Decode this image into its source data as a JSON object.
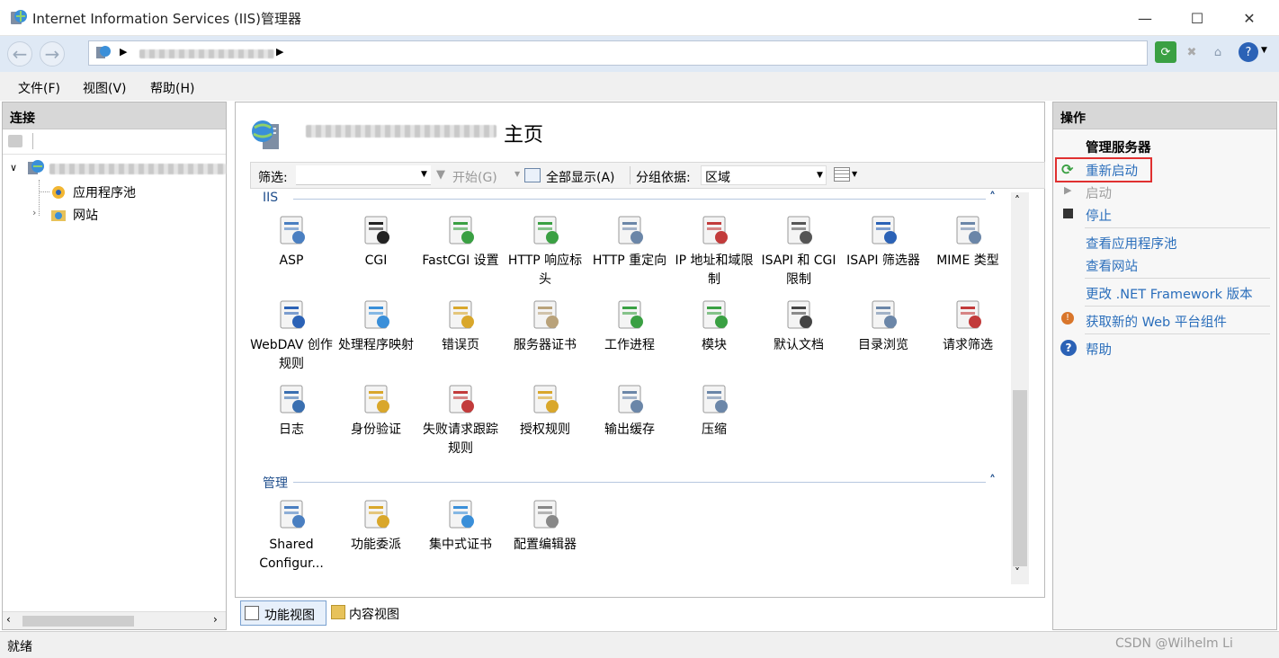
{
  "window": {
    "title": "Internet Information Services (IIS)管理器",
    "minimize": "—",
    "maximize": "☐",
    "close": "✕"
  },
  "menu": [
    "文件(F)",
    "视图(V)",
    "帮助(H)"
  ],
  "connections": {
    "header": "连接",
    "tree": [
      {
        "label": "应用程序池",
        "icon": "app-pool-icon"
      },
      {
        "label": "网站",
        "icon": "sites-folder-icon"
      }
    ]
  },
  "center": {
    "title_suffix": "主页",
    "filter": {
      "label": "筛选:",
      "start": "开始(G)",
      "show_all": "全部显示(A)",
      "group_by_label": "分组依据:",
      "group_by_value": "区域"
    },
    "groups": [
      {
        "name": "IIS",
        "items": [
          "ASP",
          "CGI",
          "FastCGI 设置",
          "HTTP 响应标头",
          "HTTP 重定向",
          "IP 地址和域限制",
          "ISAPI 和 CGI 限制",
          "ISAPI 筛选器",
          "MIME 类型",
          "WebDAV 创作规则",
          "处理程序映射",
          "错误页",
          "服务器证书",
          "工作进程",
          "模块",
          "默认文档",
          "目录浏览",
          "请求筛选",
          "日志",
          "身份验证",
          "失败请求跟踪规则",
          "授权规则",
          "输出缓存",
          "压缩"
        ]
      },
      {
        "name": "管理",
        "items": [
          "Shared Configur...",
          "功能委派",
          "集中式证书",
          "配置编辑器"
        ]
      }
    ],
    "views": {
      "features": "功能视图",
      "content": "内容视图"
    }
  },
  "actions": {
    "header": "操作",
    "section": "管理服务器",
    "restart": "重新启动",
    "start": "启动",
    "stop": "停止",
    "view_pools": "查看应用程序池",
    "view_sites": "查看网站",
    "change_net": "更改 .NET Framework 版本",
    "get_components": "获取新的 Web 平台组件",
    "help": "帮助"
  },
  "status": {
    "text": "就绪",
    "watermark": "CSDN @Wilhelm Li"
  },
  "colors": {
    "link": "#2a6ebb",
    "highlight_box": "#e03030"
  }
}
